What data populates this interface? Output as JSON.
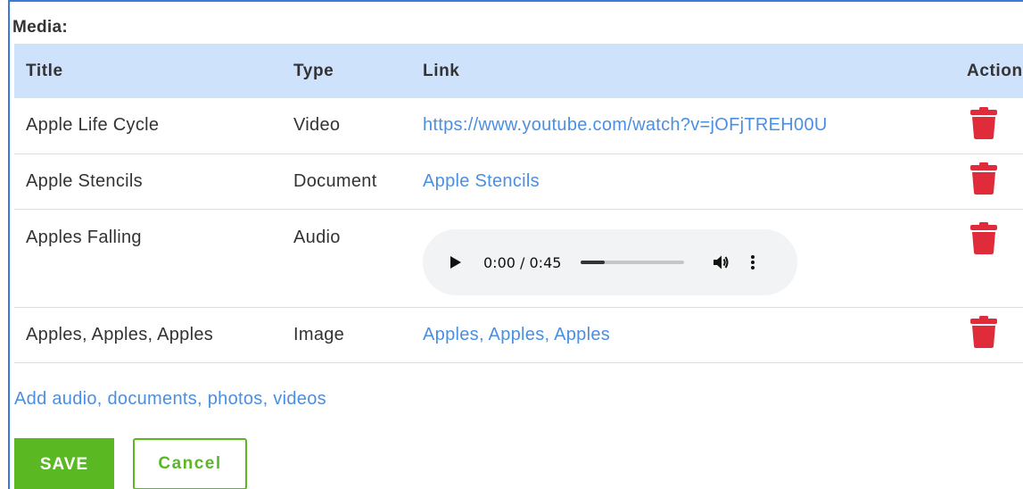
{
  "section": {
    "label": "Media:"
  },
  "table": {
    "headers": {
      "title": "Title",
      "type": "Type",
      "link": "Link",
      "action": "Action"
    },
    "rows": [
      {
        "title": "Apple Life Cycle",
        "type": "Video",
        "link": "https://www.youtube.com/watch?v=jOFjTREH00U"
      },
      {
        "title": "Apple Stencils",
        "type": "Document",
        "link": "Apple Stencils"
      },
      {
        "title": "Apples Falling",
        "type": "Audio",
        "link": ""
      },
      {
        "title": "Apples, Apples, Apples",
        "type": "Image",
        "link": "Apples, Apples, Apples"
      }
    ]
  },
  "audio_player": {
    "time": "0:00 / 0:45",
    "progress_fraction": 0.23
  },
  "add_link": "Add audio, documents, photos, videos",
  "buttons": {
    "save": "SAVE",
    "cancel": "Cancel"
  },
  "colors": {
    "accent_green": "#5ab823",
    "link_blue": "#4a8fe2",
    "header_bg": "#cfe2fb",
    "delete_red": "#e02b3a"
  },
  "icons": {
    "delete": "trash-icon",
    "play": "play-icon",
    "volume": "volume-icon",
    "more": "more-vertical-icon"
  }
}
